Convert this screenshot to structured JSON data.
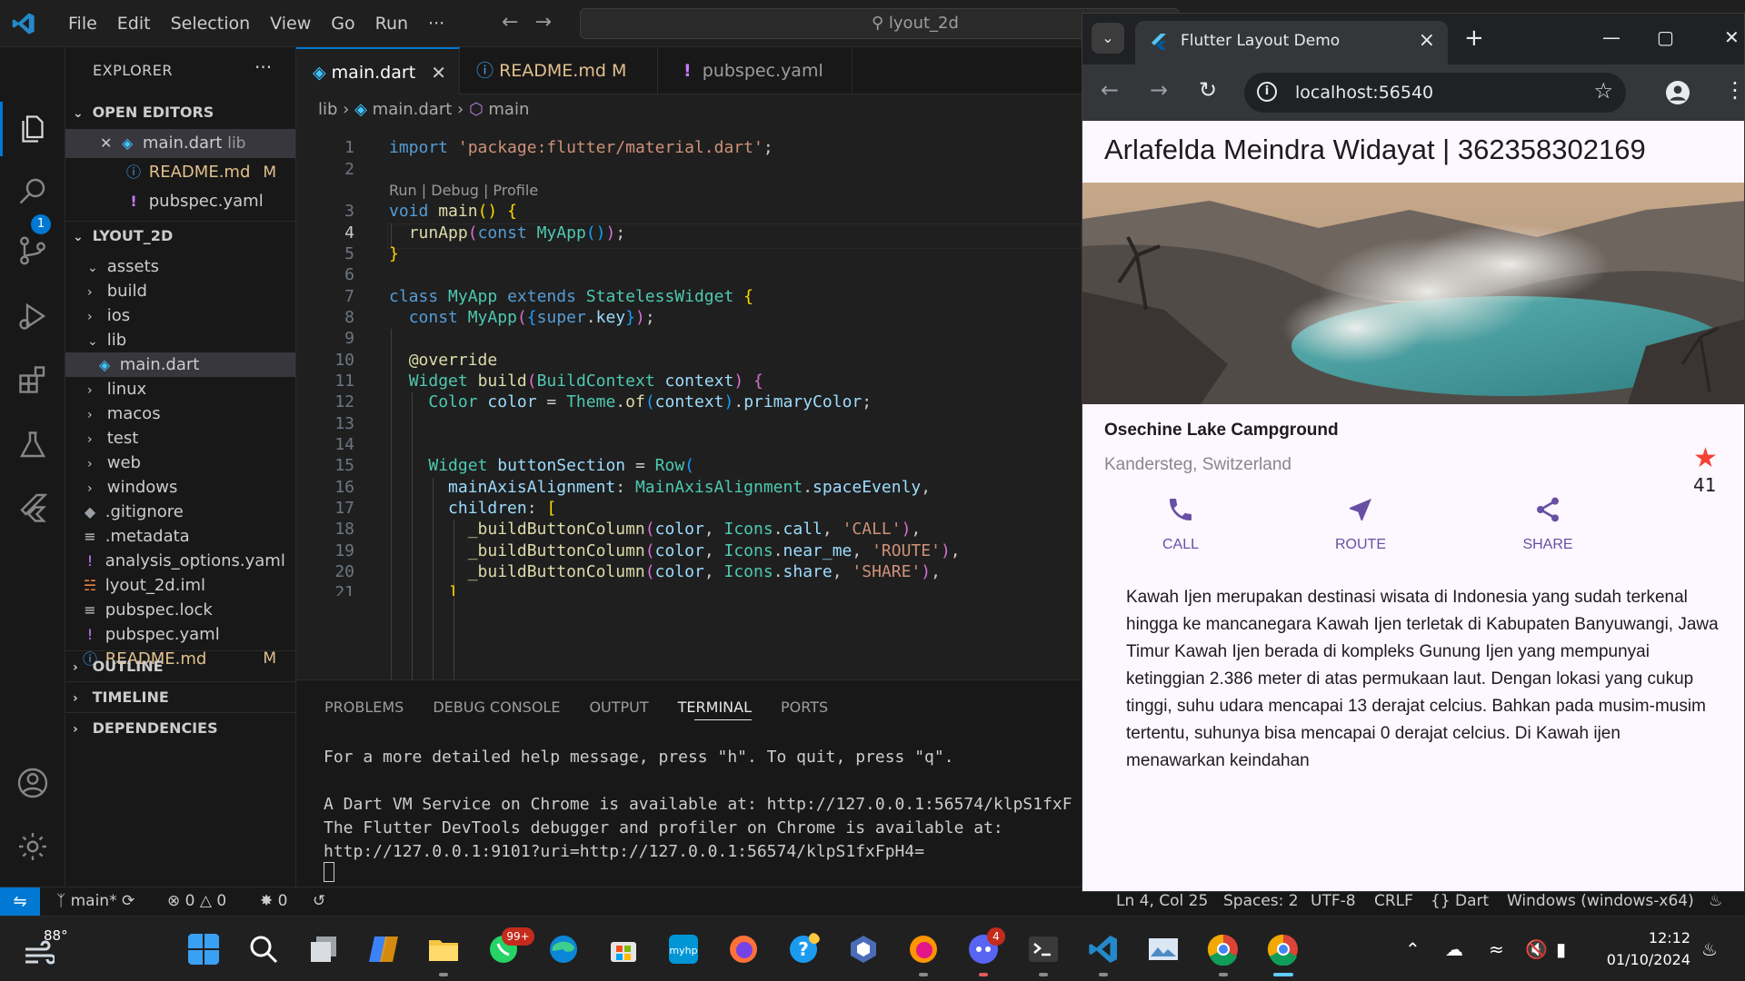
{
  "vscode": {
    "menu": [
      "File",
      "Edit",
      "Selection",
      "View",
      "Go",
      "Run",
      "···"
    ],
    "search_text": "lyout_2d",
    "explorer": {
      "header": "EXPLORER",
      "open_editors_label": "OPEN EDITORS",
      "open_editors": [
        {
          "name": "main.dart",
          "detail": "lib",
          "badge": ""
        },
        {
          "name": "README.md",
          "detail": "",
          "badge": "M"
        },
        {
          "name": "pubspec.yaml",
          "detail": "",
          "badge": ""
        }
      ],
      "project_label": "LYOUT_2D",
      "tree": [
        {
          "name": "assets",
          "kind": "folder-open",
          "depth": 1
        },
        {
          "name": "build",
          "kind": "folder",
          "depth": 1
        },
        {
          "name": "ios",
          "kind": "folder",
          "depth": 1
        },
        {
          "name": "lib",
          "kind": "folder-open",
          "depth": 1
        },
        {
          "name": "main.dart",
          "kind": "dart",
          "depth": 2
        },
        {
          "name": "linux",
          "kind": "folder",
          "depth": 1
        },
        {
          "name": "macos",
          "kind": "folder",
          "depth": 1
        },
        {
          "name": "test",
          "kind": "folder",
          "depth": 1
        },
        {
          "name": "web",
          "kind": "folder",
          "depth": 1
        },
        {
          "name": "windows",
          "kind": "folder",
          "depth": 1
        },
        {
          "name": ".gitignore",
          "kind": "git",
          "depth": 1
        },
        {
          "name": ".metadata",
          "kind": "lines",
          "depth": 1
        },
        {
          "name": "analysis_options.yaml",
          "kind": "yaml",
          "depth": 1
        },
        {
          "name": "lyout_2d.iml",
          "kind": "rss",
          "depth": 1
        },
        {
          "name": "pubspec.lock",
          "kind": "lines",
          "depth": 1
        },
        {
          "name": "pubspec.yaml",
          "kind": "yaml",
          "depth": 1
        },
        {
          "name": "README.md",
          "kind": "info",
          "depth": 1,
          "badge": "M"
        }
      ],
      "outline_label": "OUTLINE",
      "timeline_label": "TIMELINE",
      "dependencies_label": "DEPENDENCIES"
    },
    "scm_badge": "1",
    "tabs": [
      {
        "label": "main.dart",
        "badge": "",
        "close": "✕"
      },
      {
        "label": "README.md",
        "badge": "M",
        "close": ""
      },
      {
        "label": "pubspec.yaml",
        "badge": "",
        "close": ""
      }
    ],
    "breadcrumb": [
      "lib",
      "main.dart",
      "main"
    ],
    "code_lens": "Run | Debug | Profile",
    "line_numbers": [
      "1",
      "2",
      "3",
      "4",
      "5",
      "6",
      "7",
      "8",
      "9",
      "10",
      "11",
      "12",
      "13",
      "14",
      "15",
      "16",
      "17",
      "18",
      "19",
      "20",
      "21"
    ],
    "panel_tabs": [
      "PROBLEMS",
      "DEBUG CONSOLE",
      "OUTPUT",
      "TERMINAL",
      "PORTS"
    ],
    "terminal_lines": [
      "For a more detailed help message, press \"h\". To quit, press \"q\".",
      "",
      "A Dart VM Service on Chrome is available at: http://127.0.0.1:56574/klpS1fxF",
      "The Flutter DevTools debugger and profiler on Chrome is available at:",
      "http://127.0.0.1:9101?uri=http://127.0.0.1:56574/klpS1fxFpH4="
    ],
    "status": {
      "branch": "main*",
      "errors": "0",
      "warnings": "0",
      "ports": "0",
      "position": "Ln 4, Col 25",
      "spaces": "Spaces: 2",
      "encoding": "UTF-8",
      "eol": "CRLF",
      "language": "Dart",
      "device": "Windows (windows-x64)"
    }
  },
  "browser": {
    "tab_title": "Flutter Layout Demo",
    "url": "localhost:56540",
    "app": {
      "appbar_title": "Arlafelda Meindra Widayat | 362358302169",
      "place_name": "Osechine Lake Campground",
      "location": "Kandersteg, Switzerland",
      "rating": "41",
      "buttons": [
        {
          "label": "CALL",
          "icon": "phone-icon"
        },
        {
          "label": "ROUTE",
          "icon": "near-me-icon"
        },
        {
          "label": "SHARE",
          "icon": "share-icon"
        }
      ],
      "description": "Kawah Ijen merupakan destinasi wisata di Indonesia yang sudah terkenal hingga ke mancanegara Kawah Ijen terletak di Kabupaten Banyuwangi, Jawa Timur Kawah Ijen berada di kompleks Gunung Ijen yang mempunyai ketinggian 2.386 meter di atas permukaan laut. Dengan lokasi yang cukup tinggi, suhu udara mencapai 13 derajat celcius. Bahkan pada musim-musim tertentu, suhunya bisa mencapai 0 derajat celcius. Di Kawah ijen menawarkan keindahan"
    }
  },
  "taskbar": {
    "temperature": "88°",
    "whatsapp_badge": "99+",
    "discord_badge": "4",
    "time": "12:12",
    "date": "01/10/2024"
  },
  "colors": {
    "accent": "#0078d4",
    "flutter_primary": "#6750a4",
    "star": "#f44336"
  }
}
